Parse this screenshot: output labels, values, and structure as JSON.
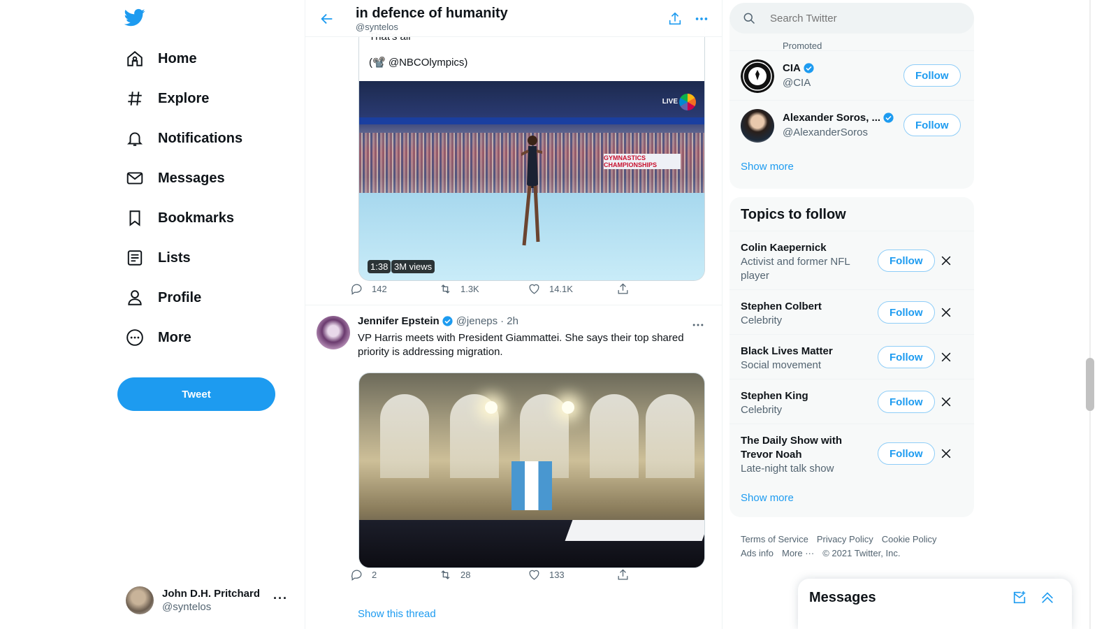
{
  "nav": {
    "items": [
      {
        "label": "Home",
        "icon": "home-icon"
      },
      {
        "label": "Explore",
        "icon": "hashtag-icon"
      },
      {
        "label": "Notifications",
        "icon": "bell-icon"
      },
      {
        "label": "Messages",
        "icon": "envelope-icon"
      },
      {
        "label": "Bookmarks",
        "icon": "bookmark-icon"
      },
      {
        "label": "Lists",
        "icon": "list-icon"
      },
      {
        "label": "Profile",
        "icon": "person-icon"
      },
      {
        "label": "More",
        "icon": "more-circle-icon"
      }
    ],
    "tweet_label": "Tweet",
    "account": {
      "name": "John D.H. Pritchard",
      "handle": "@syntelos"
    }
  },
  "header": {
    "title": "in defence of humanity",
    "subtitle": "@syntelos"
  },
  "tweet1": {
    "quote_cut_text": "That's all",
    "quote_text": "(📽️ @NBCOlympics)",
    "video_duration": "1:38",
    "video_views": "3M views",
    "video_live_label": "LIVE",
    "video_sign": "GYMNASTICS CHAMPIONSHIPS",
    "replies": "142",
    "retweets": "1.3K",
    "likes": "14.1K"
  },
  "tweet2": {
    "name": "Jennifer Epstein",
    "handle": "@jeneps",
    "time": "· 2h",
    "text": "VP Harris meets with President Giammattei. She says their top shared priority is addressing migration.",
    "replies": "2",
    "retweets": "28",
    "likes": "133",
    "show_thread": "Show this thread"
  },
  "right": {
    "search_placeholder": "Search Twitter",
    "promoted": "Promoted",
    "who_to_follow": [
      {
        "name": "CIA",
        "handle": "@CIA",
        "verified": true,
        "button": "Follow"
      },
      {
        "name": "Alexander Soros, ...",
        "handle": "@AlexanderSoros",
        "verified": true,
        "button": "Follow"
      }
    ],
    "show_more_1": "Show more",
    "topics_title": "Topics to follow",
    "topics": [
      {
        "name": "Colin Kaepernick",
        "desc": "Activist and former NFL player",
        "button": "Follow"
      },
      {
        "name": "Stephen Colbert",
        "desc": "Celebrity",
        "button": "Follow"
      },
      {
        "name": "Black Lives Matter",
        "desc": "Social movement",
        "button": "Follow"
      },
      {
        "name": "Stephen King",
        "desc": "Celebrity",
        "button": "Follow"
      },
      {
        "name": "The Daily Show with Trevor Noah",
        "desc": "Late-night talk show",
        "button": "Follow"
      }
    ],
    "show_more_2": "Show more",
    "footer": {
      "terms": "Terms of Service",
      "privacy": "Privacy Policy",
      "cookie": "Cookie Policy",
      "ads": "Ads info",
      "more": "More ···",
      "copyright": "© 2021 Twitter, Inc."
    }
  },
  "messages_dock": {
    "title": "Messages"
  },
  "colors": {
    "accent": "#1d9bf0",
    "text": "#0f1419",
    "secondary": "#536471"
  }
}
